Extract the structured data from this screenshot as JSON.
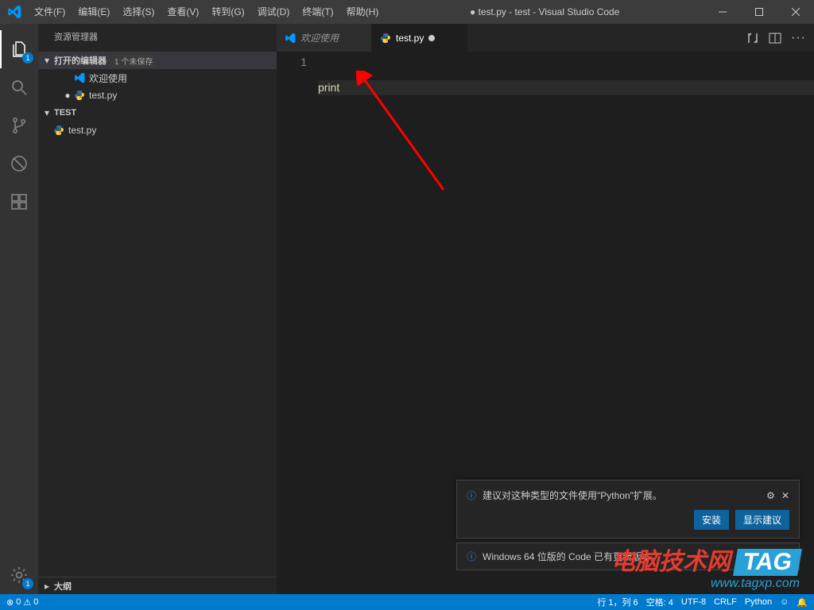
{
  "window": {
    "title": "● test.py - test - Visual Studio Code"
  },
  "menu": [
    "文件(F)",
    "编辑(E)",
    "选择(S)",
    "查看(V)",
    "转到(G)",
    "调试(D)",
    "终端(T)",
    "帮助(H)"
  ],
  "activity": {
    "explorer_badge": "1",
    "settings_badge": "1"
  },
  "sidebar": {
    "title": "资源管理器",
    "open_editors": {
      "label": "打开的编辑器",
      "meta": "1 个未保存"
    },
    "editors": [
      {
        "label": "欢迎使用",
        "icon": "vscode",
        "dot": ""
      },
      {
        "label": "test.py",
        "icon": "python",
        "dot": "●"
      }
    ],
    "folder": {
      "label": "TEST"
    },
    "files": [
      {
        "label": "test.py",
        "icon": "python"
      }
    ],
    "outline": {
      "label": "大纲"
    }
  },
  "tabs": [
    {
      "label": "欢迎使用",
      "icon": "vscode",
      "active": false,
      "dirty": false
    },
    {
      "label": "test.py",
      "icon": "python",
      "active": true,
      "dirty": true
    }
  ],
  "editor": {
    "lines": [
      {
        "n": "1",
        "text": "print"
      }
    ]
  },
  "notification1": {
    "message": "建议对这种类型的文件使用\"Python\"扩展。",
    "btn_install": "安装",
    "btn_show": "显示建议"
  },
  "notification2": {
    "message": "Windows 64 位版的 Code 已有更新版本。"
  },
  "statusbar": {
    "errors": "0",
    "warnings": "0",
    "ln_col": "行 1，列 6",
    "spaces": "空格: 4",
    "encoding": "UTF-8",
    "eol": "CRLF",
    "lang": "Python"
  },
  "watermark": {
    "line1_text": "电脑技术网",
    "line1_tag": "TAG",
    "line2": "www.tagxp.com"
  }
}
